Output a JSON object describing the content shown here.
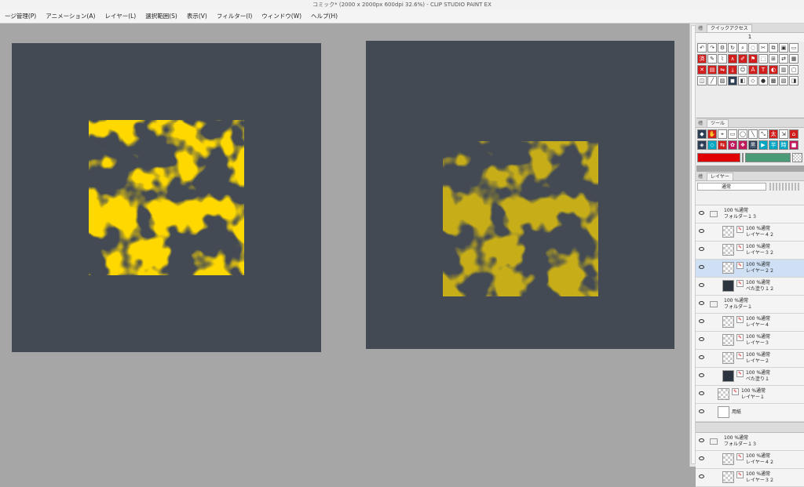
{
  "window": {
    "title": "コミック* (2000 x 2000px 600dpi 32.6%) - CLIP STUDIO PAINT EX"
  },
  "menu": [
    "ージ管理(P)",
    "アニメーション(A)",
    "レイヤー(L)",
    "選択範囲(S)",
    "表示(V)",
    "フィルター(I)",
    "ウィンドウ(W)",
    "ヘルプ(H)"
  ],
  "colors": {
    "canvas_bg": "#434a53",
    "shape_fill": "#ffb000",
    "workspace": "#a6a6a6"
  },
  "quick_access": {
    "tab_label": "クイックアクセス",
    "set_number": "1"
  },
  "tool_panel": {
    "tab_label": "ツール"
  },
  "layer_panel": {
    "tab_label": "レイヤー",
    "blend_mode": "通常",
    "layers": [
      {
        "mode": "100 %通常",
        "name": "フォルダー１３",
        "type": "folder"
      },
      {
        "mode": "100 %通常",
        "name": "レイヤー４２",
        "type": "layer"
      },
      {
        "mode": "100 %通常",
        "name": "レイヤー３２",
        "type": "layer"
      },
      {
        "mode": "100 %通常",
        "name": "レイヤー２２",
        "type": "layer",
        "selected": true
      },
      {
        "mode": "100 %通常",
        "name": "べた塗り１２",
        "type": "fill"
      },
      {
        "mode": "100 %通常",
        "name": "フォルダー１",
        "type": "folder"
      },
      {
        "mode": "100 %通常",
        "name": "レイヤー４",
        "type": "layer"
      },
      {
        "mode": "100 %通常",
        "name": "レイヤー３",
        "type": "layer"
      },
      {
        "mode": "100 %通常",
        "name": "レイヤー２",
        "type": "layer"
      },
      {
        "mode": "100 %通常",
        "name": "べた塗り１",
        "type": "fill"
      },
      {
        "mode": "100 %通常",
        "name": "レイヤー１",
        "type": "layer"
      },
      {
        "mode": "",
        "name": "用紙",
        "type": "paper"
      }
    ],
    "layers_lower": [
      {
        "mode": "100 %通常",
        "name": "フォルダー１３",
        "type": "folder"
      },
      {
        "mode": "100 %通常",
        "name": "レイヤー４２",
        "type": "layer"
      },
      {
        "mode": "100 %通常",
        "name": "レイヤー３２",
        "type": "layer"
      }
    ]
  }
}
